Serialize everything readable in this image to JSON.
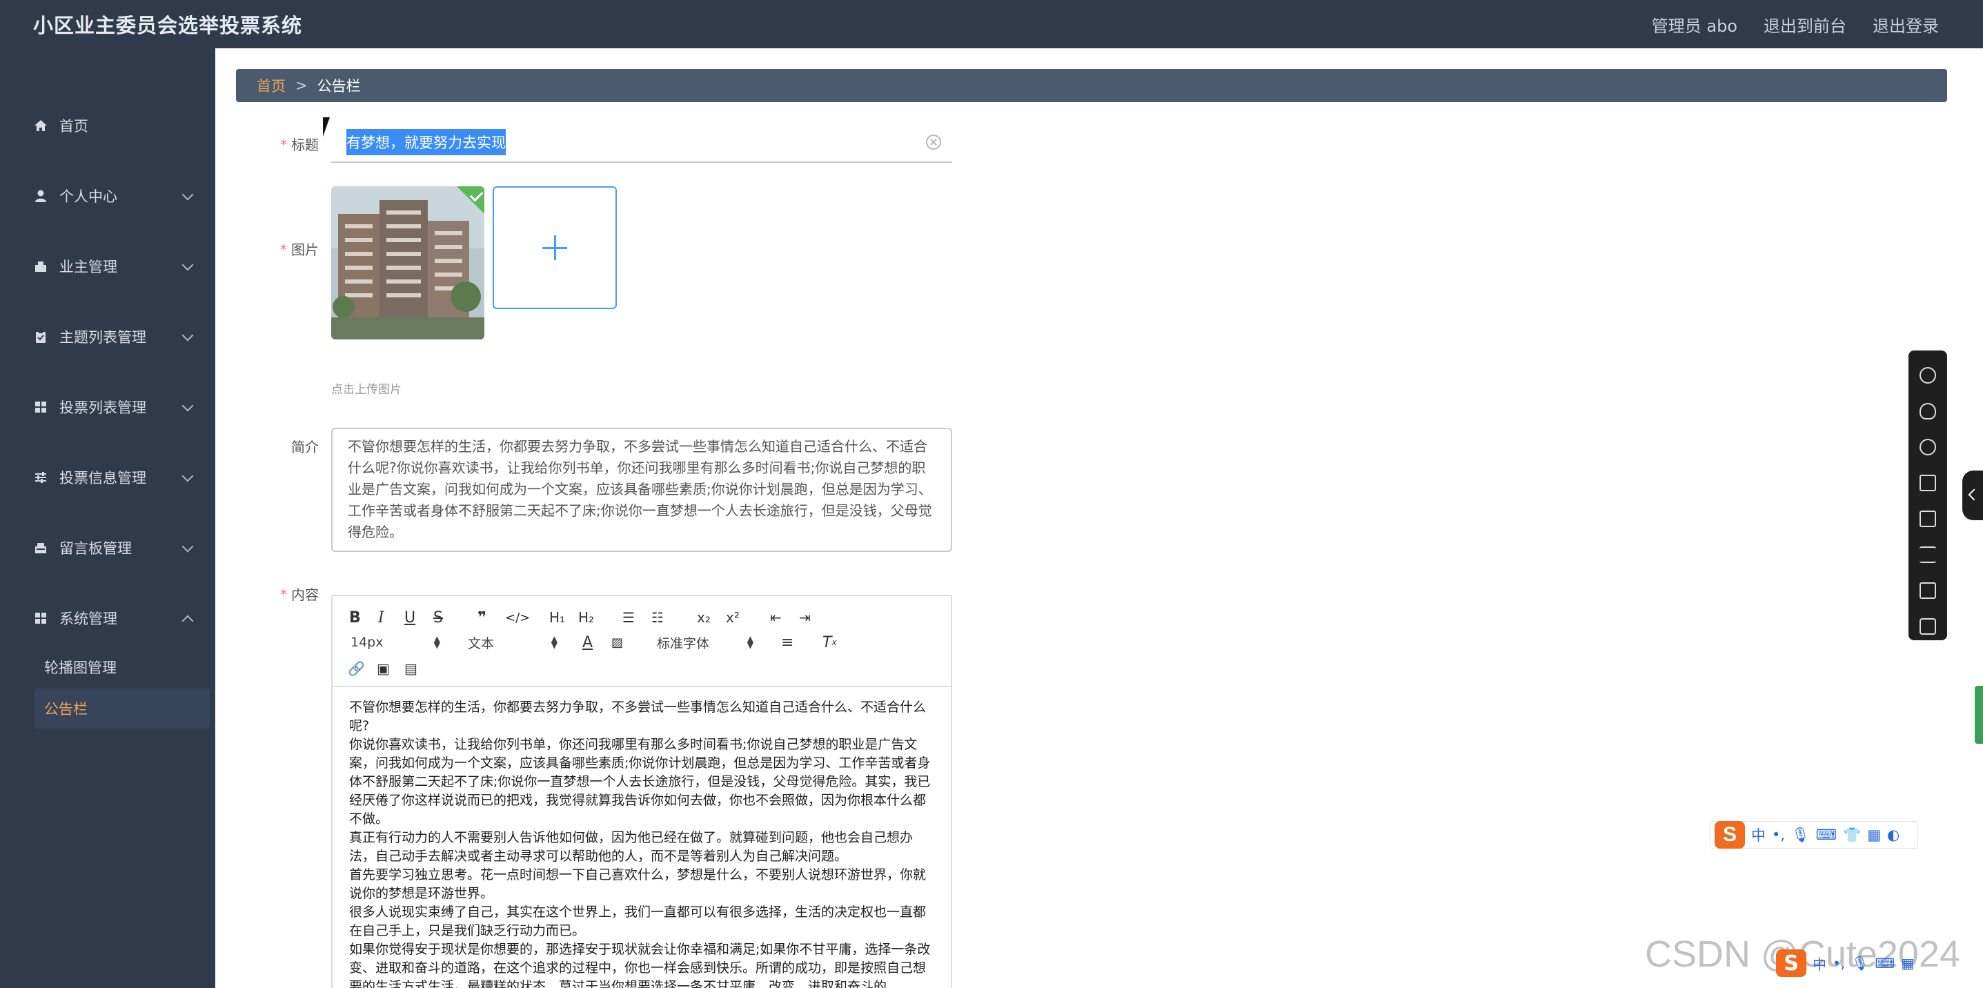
{
  "header": {
    "app_title": "小区业主委员会选举投票系统",
    "links": [
      "管理员 abo",
      "退出到前台",
      "退出登录"
    ]
  },
  "sidebar": {
    "items": [
      {
        "label": "首页",
        "icon": "home-icon",
        "has_submenu": false
      },
      {
        "label": "个人中心",
        "icon": "user-icon",
        "has_submenu": true
      },
      {
        "label": "业主管理",
        "icon": "owner-icon",
        "has_submenu": true
      },
      {
        "label": "主题列表管理",
        "icon": "clipboard-icon",
        "has_submenu": true
      },
      {
        "label": "投票列表管理",
        "icon": "grid-icon",
        "has_submenu": true
      },
      {
        "label": "投票信息管理",
        "icon": "sliders-icon",
        "has_submenu": true
      },
      {
        "label": "留言板管理",
        "icon": "message-icon",
        "has_submenu": true
      },
      {
        "label": "系统管理",
        "icon": "grid-icon",
        "has_submenu": true
      }
    ],
    "subitems": [
      {
        "label": "轮播图管理",
        "active": false
      },
      {
        "label": "公告栏",
        "active": true
      }
    ],
    "active_color": "#f0a35c"
  },
  "breadcrumb": {
    "home": "首页",
    "separator": ">",
    "current": "公告栏"
  },
  "form": {
    "title_label": "标题",
    "title_value": "有梦想，就要努力去实现",
    "image_label": "图片",
    "upload_tip": "点击上传图片",
    "intro_label": "简介",
    "intro_value": "不管你想要怎样的生活，你都要去努力争取，不多尝试一些事情怎么知道自己适合什么、不适合什么呢?你说你喜欢读书，让我给你列书单，你还问我哪里有那么多时间看书;你说自己梦想的职业是广告文案，问我如何成为一个文案，应该具备哪些素质;你说你计划晨跑，但总是因为学习、工作辛苦或者身体不舒服第二天起不了床;你说你一直梦想一个人去长途旅行，但是没钱，父母觉得危险。",
    "content_label": "内容"
  },
  "editor": {
    "font_size": "14px",
    "format": "文本",
    "font_family": "标准字体",
    "paragraphs": [
      "不管你想要怎样的生活，你都要去努力争取，不多尝试一些事情怎么知道自己适合什么、不适合什么呢?",
      "你说你喜欢读书，让我给你列书单，你还问我哪里有那么多时间看书;你说自己梦想的职业是广告文案，问我如何成为一个文案，应该具备哪些素质;你说你计划晨跑，但总是因为学习、工作辛苦或者身体不舒服第二天起不了床;你说你一直梦想一个人去长途旅行，但是没钱，父母觉得危险。其实，我已经厌倦了你这样说说而已的把戏，我觉得就算我告诉你如何去做，你也不会照做，因为你根本什么都不做。",
      "真正有行动力的人不需要别人告诉他如何做，因为他已经在做了。就算碰到问题，他也会自己想办法，自己动手去解决或者主动寻求可以帮助他的人，而不是等着别人为自己解决问题。",
      "首先要学习独立思考。花一点时间想一下自己喜欢什么，梦想是什么，不要别人说想环游世界，你就说你的梦想是环游世界。",
      "很多人说现实束缚了自己，其实在这个世界上，我们一直都可以有很多选择，生活的决定权也一直都在自己手上，只是我们缺乏行动力而已。",
      "如果你觉得安于现状是你想要的，那选择安于现状就会让你幸福和满足;如果你不甘平庸，选择一条改变、进取和奋斗的道路，在这个追求的过程中，你也一样会感到快乐。所谓的成功，即是按照自己想要的生活方式生活。最糟糕的状态，莫过于当你想要选择一条不甘平庸、改变、进取和奋斗的"
    ]
  },
  "ime": {
    "logo": "S",
    "mode": "中"
  },
  "watermark": "CSDN @Cute2024"
}
